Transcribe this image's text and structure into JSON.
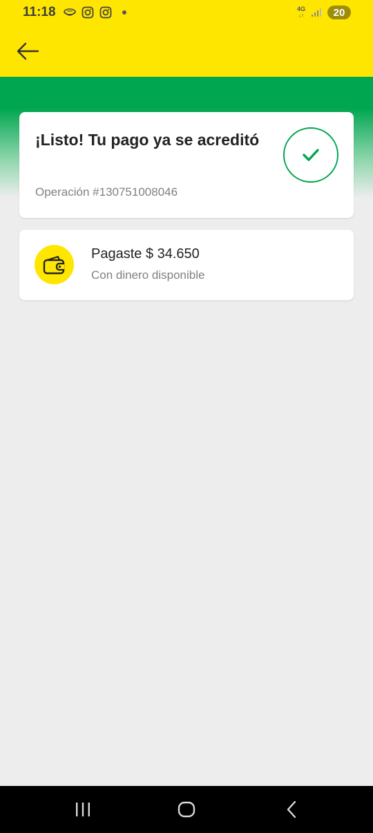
{
  "status_bar": {
    "time": "11:18",
    "network_type": "4G",
    "battery_level": "20",
    "notification_icons": [
      "bowl-icon",
      "instagram-icon",
      "instagram-icon"
    ],
    "signal_icon": "signal-bars-icon"
  },
  "app_bar": {
    "back_icon": "arrow-left-icon"
  },
  "success": {
    "title": "¡Listo! Tu pago ya se acreditó",
    "operation": "Operación #130751008046",
    "status_icon": "check-icon"
  },
  "payment": {
    "amount_text": "Pagaste $ 34.650",
    "method_text": "Con dinero disponible",
    "icon": "wallet-icon"
  },
  "nav_bar": {
    "recents_icon": "recents-icon",
    "home_icon": "home-icon",
    "back_icon": "back-chevron-icon"
  },
  "colors": {
    "brand_yellow": "#ffe600",
    "success_green": "#00a650",
    "background": "#ededed",
    "muted_text": "#808080"
  }
}
